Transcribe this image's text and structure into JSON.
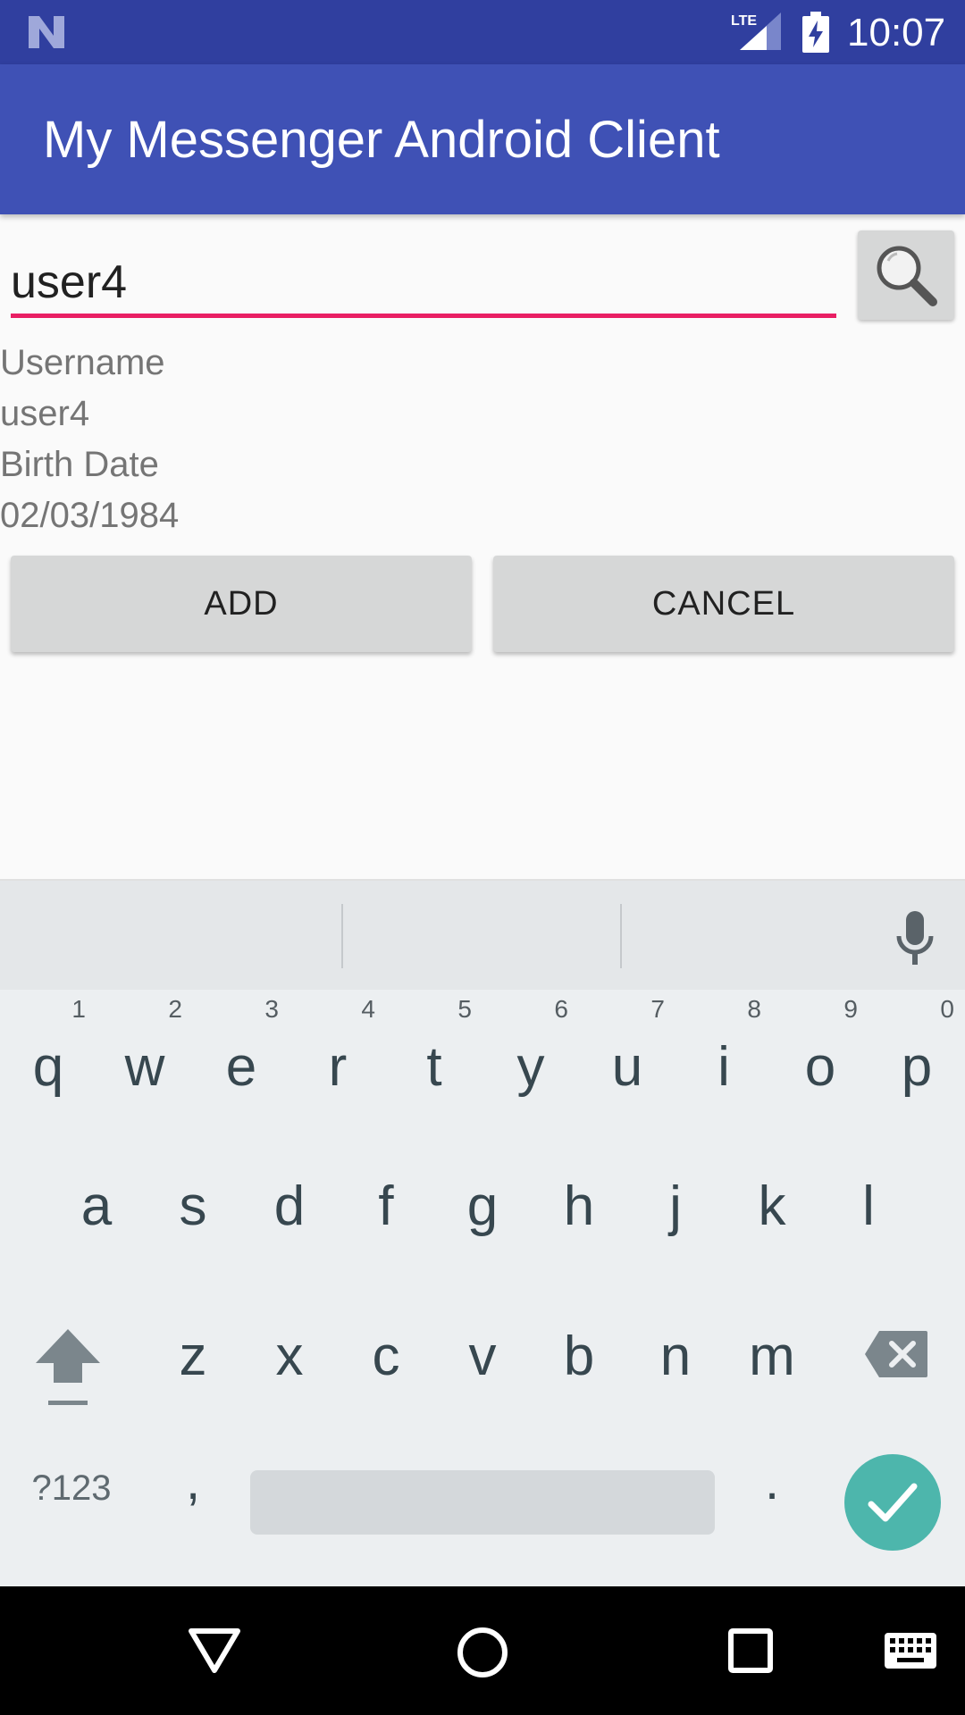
{
  "status_bar": {
    "time": "10:07",
    "network": "LTE"
  },
  "app_bar": {
    "title": "My Messenger Android Client"
  },
  "search": {
    "value": "user4",
    "button_icon": "search-icon"
  },
  "details": {
    "username_label": "Username",
    "username_value": "user4",
    "birth_label": "Birth Date",
    "birth_value": "02/03/1984"
  },
  "buttons": {
    "add": "ADD",
    "cancel": "CANCEL"
  },
  "keyboard": {
    "row1": [
      {
        "key": "q",
        "hint": "1"
      },
      {
        "key": "w",
        "hint": "2"
      },
      {
        "key": "e",
        "hint": "3"
      },
      {
        "key": "r",
        "hint": "4"
      },
      {
        "key": "t",
        "hint": "5"
      },
      {
        "key": "y",
        "hint": "6"
      },
      {
        "key": "u",
        "hint": "7"
      },
      {
        "key": "i",
        "hint": "8"
      },
      {
        "key": "o",
        "hint": "9"
      },
      {
        "key": "p",
        "hint": "0"
      }
    ],
    "row2": [
      "a",
      "s",
      "d",
      "f",
      "g",
      "h",
      "j",
      "k",
      "l"
    ],
    "row3": [
      "z",
      "x",
      "c",
      "v",
      "b",
      "n",
      "m"
    ],
    "symbols_key": "?123",
    "comma_key": ",",
    "period_key": "."
  },
  "colors": {
    "status_bar": "#303f9f",
    "app_bar": "#3f51b5",
    "accent": "#e91e63",
    "done_key": "#4db6ac"
  }
}
